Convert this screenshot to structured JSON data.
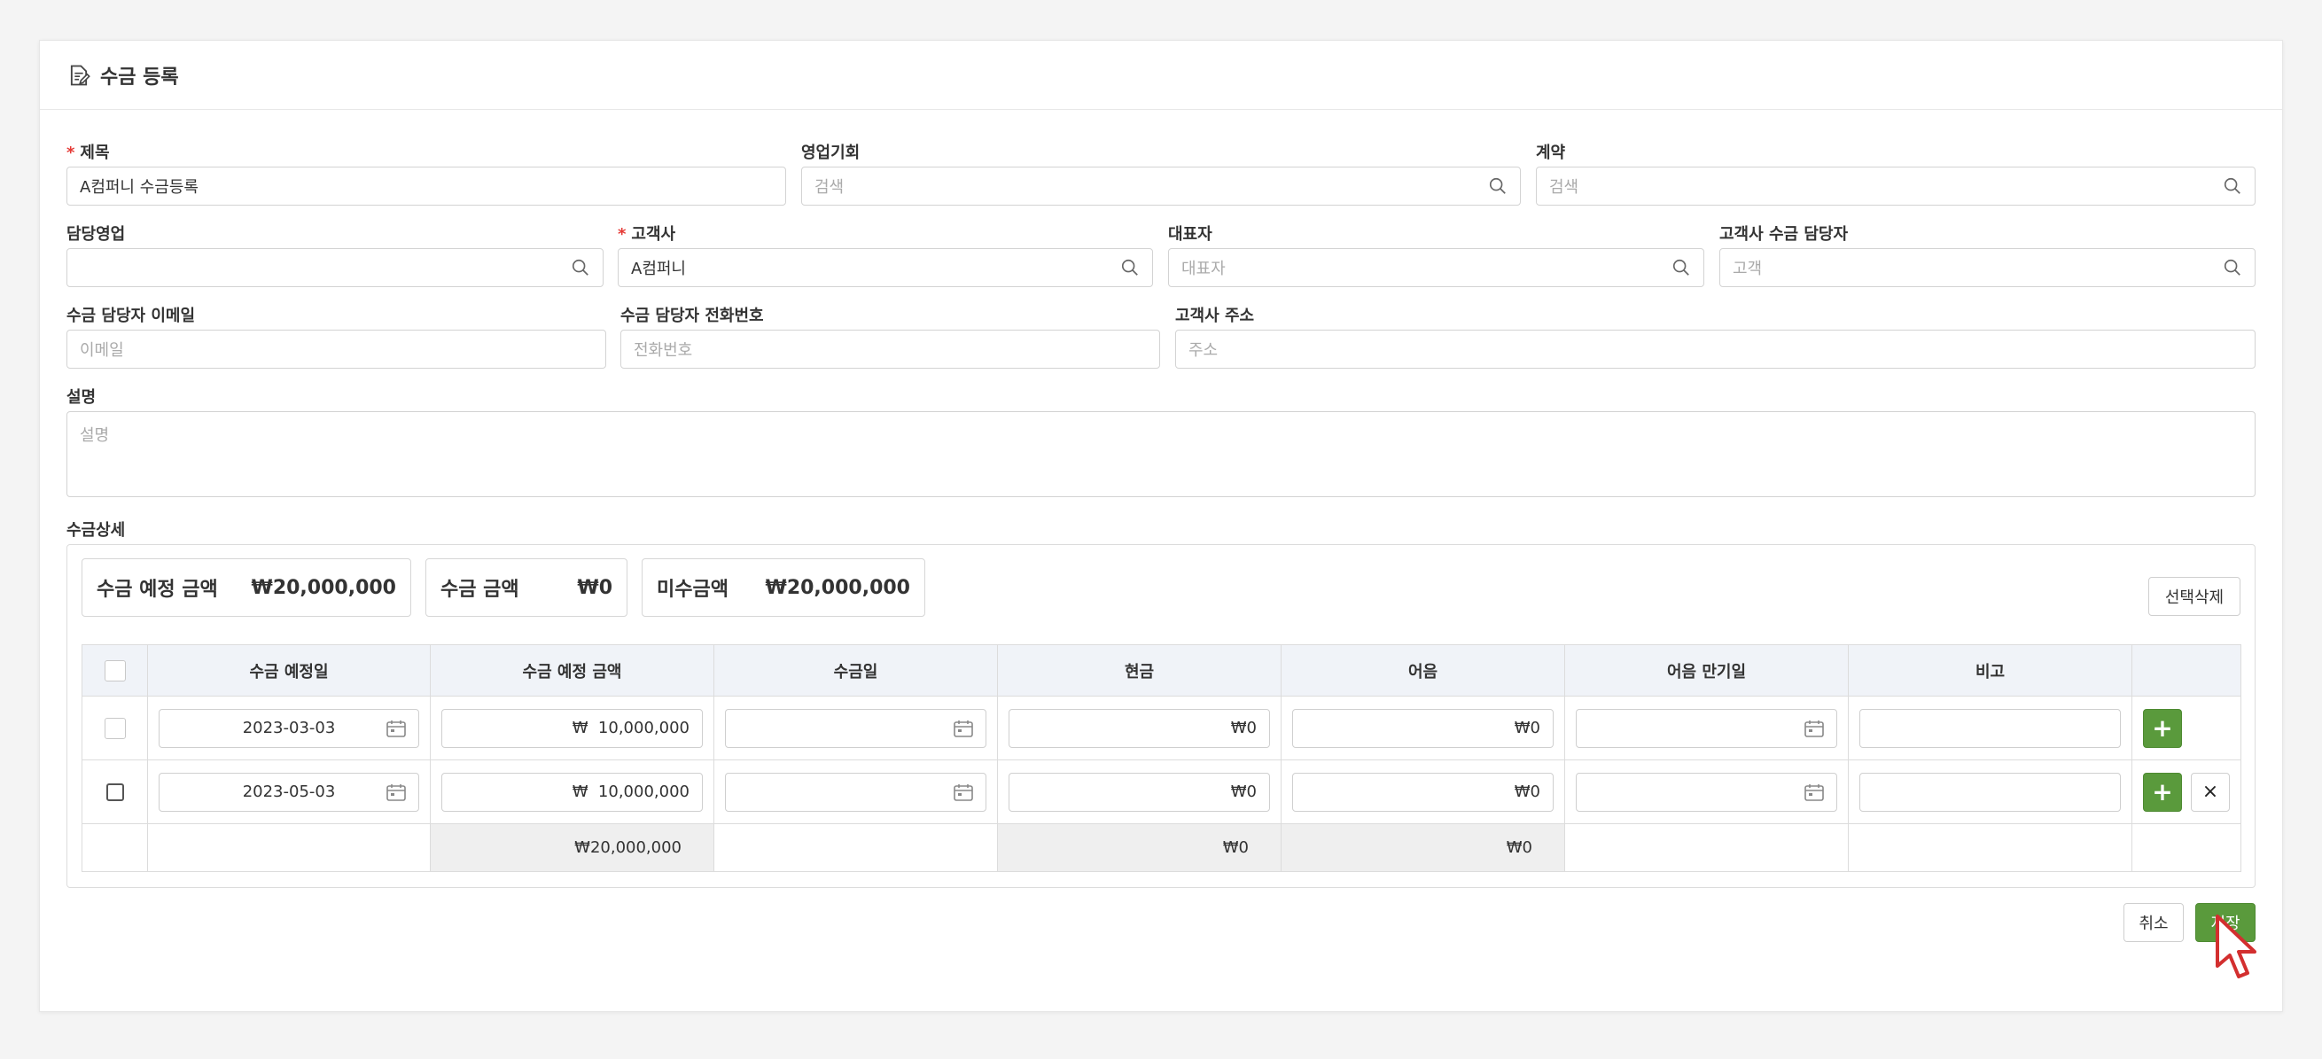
{
  "header": {
    "title": "수금 등록",
    "icon": "document-edit-icon"
  },
  "fields": {
    "title": {
      "label": "제목",
      "value": "A컴퍼니 수금등록"
    },
    "opportunity": {
      "label": "영업기회",
      "placeholder": "검색"
    },
    "contract": {
      "label": "계약",
      "placeholder": "검색"
    },
    "sales_rep": {
      "label": "담당영업",
      "value": ""
    },
    "customer": {
      "label": "고객사",
      "value": "A컴퍼니"
    },
    "representative": {
      "label": "대표자",
      "placeholder": "대표자"
    },
    "customer_contact": {
      "label": "고객사 수금 담당자",
      "placeholder": "고객"
    },
    "contact_email": {
      "label": "수금 담당자 이메일",
      "placeholder": "이메일"
    },
    "contact_phone": {
      "label": "수금 담당자 전화번호",
      "placeholder": "전화번호"
    },
    "customer_address": {
      "label": "고객사 주소",
      "placeholder": "주소"
    },
    "description": {
      "label": "설명",
      "placeholder": "설명"
    },
    "required_mark": "*"
  },
  "details": {
    "section_label": "수금상세",
    "summary": [
      {
        "label": "수금 예정 금액",
        "value": "₩20,000,000"
      },
      {
        "label": "수금 금액",
        "value": "₩0"
      },
      {
        "label": "미수금액",
        "value": "₩20,000,000"
      }
    ],
    "delete_selected": "선택삭제",
    "columns": [
      "수금 예정일",
      "수금 예정 금액",
      "수금일",
      "현금",
      "어음",
      "어음 만기일",
      "비고"
    ],
    "rows": [
      {
        "scheduled_date": "2023-03-03",
        "scheduled_amount": "₩  10,000,000",
        "collected_date": "",
        "cash": "₩0",
        "note_bill": "₩0",
        "bill_due": "",
        "remark": ""
      },
      {
        "scheduled_date": "2023-05-03",
        "scheduled_amount": "₩  10,000,000",
        "collected_date": "",
        "cash": "₩0",
        "note_bill": "₩0",
        "bill_due": "",
        "remark": ""
      }
    ],
    "totals": {
      "scheduled_amount": "₩20,000,000",
      "cash": "₩0",
      "note_bill": "₩0"
    },
    "add_symbol": "+",
    "remove_symbol": "×"
  },
  "footer": {
    "cancel": "취소",
    "save": "저장"
  },
  "colors": {
    "accent_green": "#5a9a3c",
    "required_red": "#e53935",
    "header_bg": "#f0f3f8"
  }
}
